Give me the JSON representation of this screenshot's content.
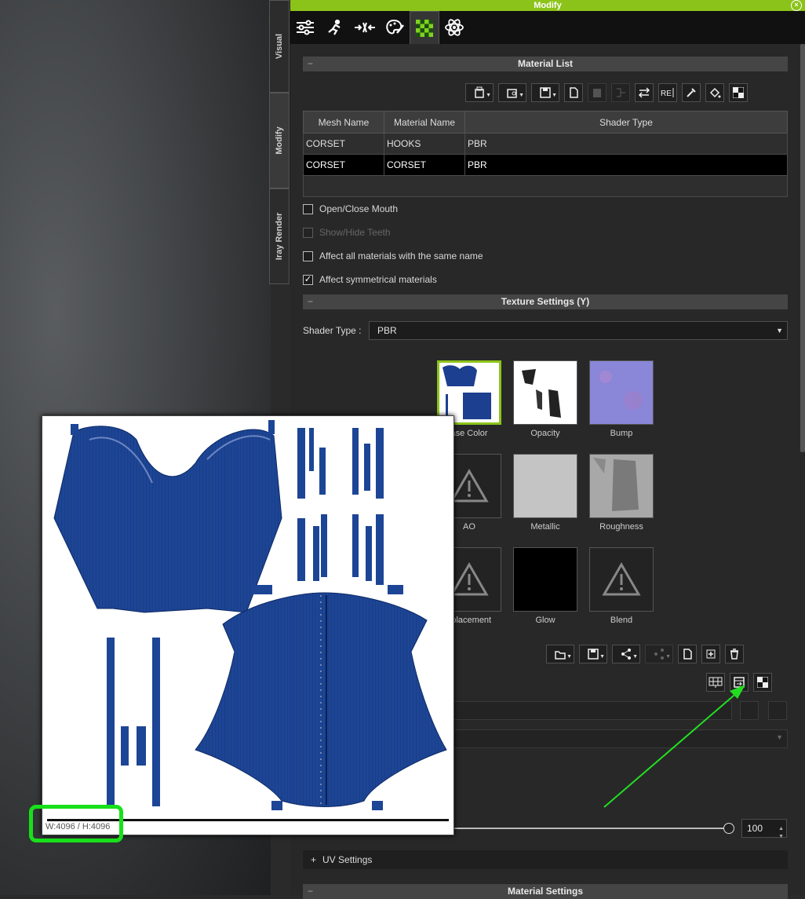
{
  "window": {
    "title": "Modify"
  },
  "side_tabs": [
    {
      "label": "Visual"
    },
    {
      "label": "Modify"
    },
    {
      "label": "Iray Render"
    }
  ],
  "top_tabs": [
    "sliders-icon",
    "motion-icon",
    "morph-icon",
    "palette-icon",
    "checker-icon",
    "atom-icon"
  ],
  "material_list": {
    "header": "Material List",
    "columns": [
      "Mesh Name",
      "Material Name",
      "Shader Type"
    ],
    "rows": [
      {
        "mesh": "CORSET",
        "material": "HOOKS",
        "shader": "PBR",
        "selected": false
      },
      {
        "mesh": "CORSET",
        "material": "CORSET",
        "shader": "PBR",
        "selected": true
      }
    ]
  },
  "options": [
    {
      "label": "Open/Close Mouth",
      "checked": false,
      "enabled": true
    },
    {
      "label": "Show/Hide Teeth",
      "checked": false,
      "enabled": false
    },
    {
      "label": "Affect all materials with the same name",
      "checked": false,
      "enabled": true
    },
    {
      "label": "Affect symmetrical materials",
      "checked": true,
      "enabled": true
    }
  ],
  "texture_settings": {
    "header": "Texture Settings  (Y)",
    "shader_label": "Shader Type :",
    "shader_value": "PBR",
    "slots": [
      {
        "label": "Base Color",
        "selected": true
      },
      {
        "label": "Opacity"
      },
      {
        "label": "Bump"
      },
      {
        "label": "AO"
      },
      {
        "label": "Metallic"
      },
      {
        "label": "Roughness"
      },
      {
        "label": "Displacement"
      },
      {
        "label": "Glow"
      },
      {
        "label": "Blend"
      }
    ],
    "visible_labels": {
      "base_color": "ase Color",
      "ao": "AO",
      "displacement": "splacement"
    },
    "strength_value": "100"
  },
  "uv_settings": {
    "label": "UV Settings",
    "prefix": "+"
  },
  "material_settings": {
    "header": "Material Settings",
    "prefix": "−"
  },
  "preview": {
    "size_text": "W:4096 / H:4096"
  },
  "colors": {
    "accent": "#8cc31a",
    "highlight": "#18e01a",
    "arrow": "#22dd22"
  }
}
